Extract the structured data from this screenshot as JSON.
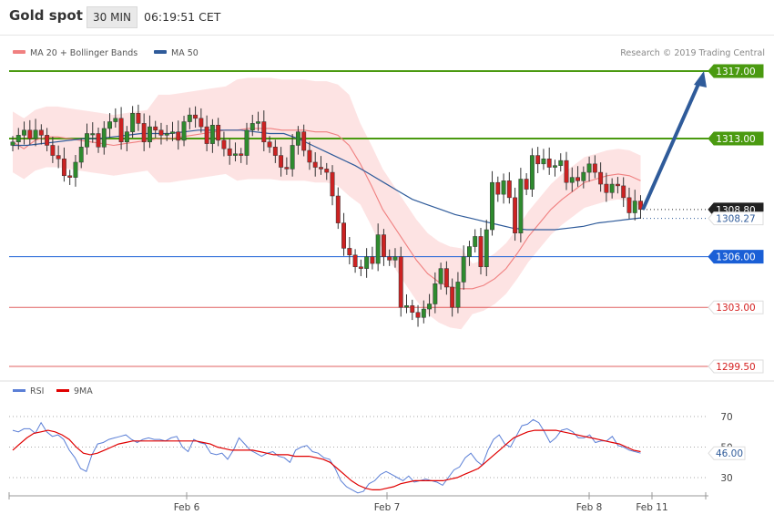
{
  "header": {
    "title": "Gold spot",
    "timeframe": "30 MIN",
    "time": "06:19:51 CET"
  },
  "legend": {
    "bollinger": {
      "label": "MA 20 + Bollinger Bands",
      "color": "#f08080"
    },
    "ma50": {
      "label": "MA 50",
      "color": "#2f5b9a"
    },
    "credit": "Research © 2019 Trading Central"
  },
  "rsi_legend": {
    "rsi": "RSI",
    "rsi_color": "#5b7fd6",
    "ma": "9MA",
    "ma_color": "#e00000"
  },
  "x_labels": [
    "Feb 6",
    "Feb 7",
    "Feb 8",
    "Feb 11"
  ],
  "chart_data": [
    {
      "type": "candlestick",
      "ylim": [
        1299.2,
        1317.5
      ],
      "levels": [
        {
          "value": 1317.0,
          "label": "1317.00",
          "kind": "resistance",
          "color": "#4a9a10"
        },
        {
          "value": 1313.0,
          "label": "1313.00",
          "kind": "resistance",
          "color": "#4a9a10"
        },
        {
          "value": 1308.8,
          "label": "1308.80",
          "kind": "last",
          "color": "#222222"
        },
        {
          "value": 1308.27,
          "label": "1308.27",
          "kind": "ma50",
          "color": "#2f5b9a"
        },
        {
          "value": 1306.0,
          "label": "1306.00",
          "kind": "pivot",
          "color": "#1a5fd6"
        },
        {
          "value": 1303.0,
          "label": "1303.00",
          "kind": "support",
          "color": "#d42020"
        },
        {
          "value": 1299.5,
          "label": "1299.50",
          "kind": "support",
          "color": "#d42020"
        }
      ],
      "series": [
        {
          "name": "Candles",
          "values": [
            1312.8,
            1313.2,
            1313.5,
            1313.0,
            1313.5,
            1313.2,
            1312.6,
            1312.0,
            1311.8,
            1310.8,
            1310.7,
            1311.6,
            1312.5,
            1313.3,
            1313.3,
            1312.5,
            1313.6,
            1314.0,
            1314.2,
            1312.8,
            1313.4,
            1314.5,
            1313.9,
            1312.8,
            1313.7,
            1313.5,
            1313.2,
            1313.3,
            1313.4,
            1312.9,
            1314.0,
            1314.4,
            1314.2,
            1313.7,
            1312.7,
            1313.8,
            1312.9,
            1312.4,
            1312.0,
            1312.1,
            1312.0,
            1313.5,
            1313.9,
            1314.0,
            1312.8,
            1312.5,
            1312.0,
            1311.3,
            1311.2,
            1312.6,
            1313.4,
            1312.3,
            1311.6,
            1311.3,
            1311.2,
            1311.0,
            1309.6,
            1308.0,
            1306.5,
            1306.1,
            1305.4,
            1305.3,
            1306.0,
            1305.6,
            1307.3,
            1306.0,
            1305.8,
            1306.0,
            1303.0,
            1303.1,
            1302.7,
            1302.4,
            1302.9,
            1303.2,
            1304.4,
            1305.3,
            1304.2,
            1303.0,
            1304.5,
            1306.0,
            1306.6,
            1307.2,
            1305.4,
            1307.6,
            1310.4,
            1309.7,
            1310.5,
            1309.5,
            1307.4,
            1310.6,
            1310.0,
            1312.0,
            1311.5,
            1311.8,
            1311.3,
            1311.4,
            1311.7,
            1310.4,
            1310.7,
            1310.5,
            1311.0,
            1311.5,
            1311.0,
            1310.3,
            1309.8,
            1310.3,
            1310.2,
            1309.5,
            1308.6,
            1309.3,
            1308.8
          ]
        },
        {
          "name": "MA 20",
          "values": [
            1312.8,
            1312.4,
            1312.9,
            1313.1,
            1313.1,
            1313.0,
            1312.9,
            1312.8,
            1312.7,
            1312.6,
            1312.7,
            1312.8,
            1312.9,
            1313.0,
            1313.0,
            1313.1,
            1313.2,
            1313.3,
            1313.4,
            1313.5,
            1313.5,
            1313.6,
            1313.6,
            1313.6,
            1313.5,
            1313.5,
            1313.5,
            1313.4,
            1313.4,
            1313.2,
            1312.6,
            1311.5,
            1310.2,
            1308.8,
            1307.8,
            1306.8,
            1305.8,
            1305.0,
            1304.5,
            1304.2,
            1304.1,
            1304.1,
            1304.3,
            1304.7,
            1305.3,
            1306.2,
            1307.2,
            1308.0,
            1308.8,
            1309.4,
            1309.9,
            1310.4,
            1310.6,
            1310.8,
            1310.9,
            1310.8,
            1310.5
          ]
        },
        {
          "name": "MA 50",
          "values": [
            1312.6,
            1312.6,
            1312.7,
            1312.8,
            1312.9,
            1313.0,
            1313.0,
            1313.1,
            1313.2,
            1313.3,
            1313.3,
            1313.3,
            1313.4,
            1313.5,
            1313.5,
            1313.5,
            1313.5,
            1313.4,
            1313.3,
            1313.3,
            1313.0,
            1312.6,
            1312.2,
            1311.8,
            1311.4,
            1310.9,
            1310.4,
            1309.9,
            1309.4,
            1309.1,
            1308.8,
            1308.5,
            1308.3,
            1308.1,
            1307.9,
            1307.7,
            1307.6,
            1307.6,
            1307.6,
            1307.7,
            1307.8,
            1308.0,
            1308.1,
            1308.2,
            1308.3
          ]
        }
      ]
    },
    {
      "type": "line",
      "title": "RSI",
      "ylim": [
        15,
        85
      ],
      "ticks": [
        70,
        50,
        30
      ],
      "series": [
        {
          "name": "RSI",
          "values": [
            61,
            60,
            62,
            62,
            59,
            66,
            60,
            57,
            58,
            55,
            48,
            43,
            36,
            34,
            45,
            52,
            53,
            55,
            56,
            57,
            58,
            55,
            53,
            55,
            56,
            55,
            55,
            54,
            56,
            57,
            50,
            47,
            55,
            53,
            52,
            46,
            45,
            46,
            42,
            48,
            56,
            52,
            48,
            46,
            44,
            46,
            47,
            44,
            43,
            40,
            48,
            50,
            51,
            47,
            46,
            43,
            42,
            36,
            28,
            24,
            22,
            20,
            21,
            26,
            28,
            32,
            34,
            32,
            30,
            28,
            31,
            27,
            28,
            29,
            28,
            27,
            25,
            30,
            35,
            37,
            43,
            46,
            41,
            38,
            48,
            55,
            58,
            52,
            50,
            57,
            64,
            65,
            68,
            66,
            60,
            53,
            56,
            61,
            62,
            60,
            56,
            56,
            58,
            53,
            54,
            54,
            57,
            51,
            50,
            48,
            47,
            46
          ]
        },
        {
          "name": "9MA",
          "values": [
            48,
            52,
            56,
            59,
            60,
            61,
            60,
            58,
            55,
            50,
            46,
            45,
            46,
            48,
            50,
            52,
            53,
            54,
            54,
            54,
            54,
            54,
            54,
            54,
            54,
            54,
            54,
            53,
            52,
            50,
            49,
            48,
            48,
            48,
            48,
            47,
            46,
            45,
            45,
            45,
            44,
            44,
            44,
            43,
            42,
            40,
            36,
            32,
            28,
            25,
            23,
            22,
            22,
            23,
            24,
            26,
            27,
            28,
            28,
            28,
            28,
            28,
            29,
            30,
            32,
            34,
            36,
            40,
            44,
            48,
            52,
            56,
            58,
            60,
            61,
            61,
            61,
            61,
            60,
            59,
            58,
            57,
            56,
            55,
            54,
            53,
            52,
            50,
            48,
            47
          ]
        }
      ]
    }
  ]
}
